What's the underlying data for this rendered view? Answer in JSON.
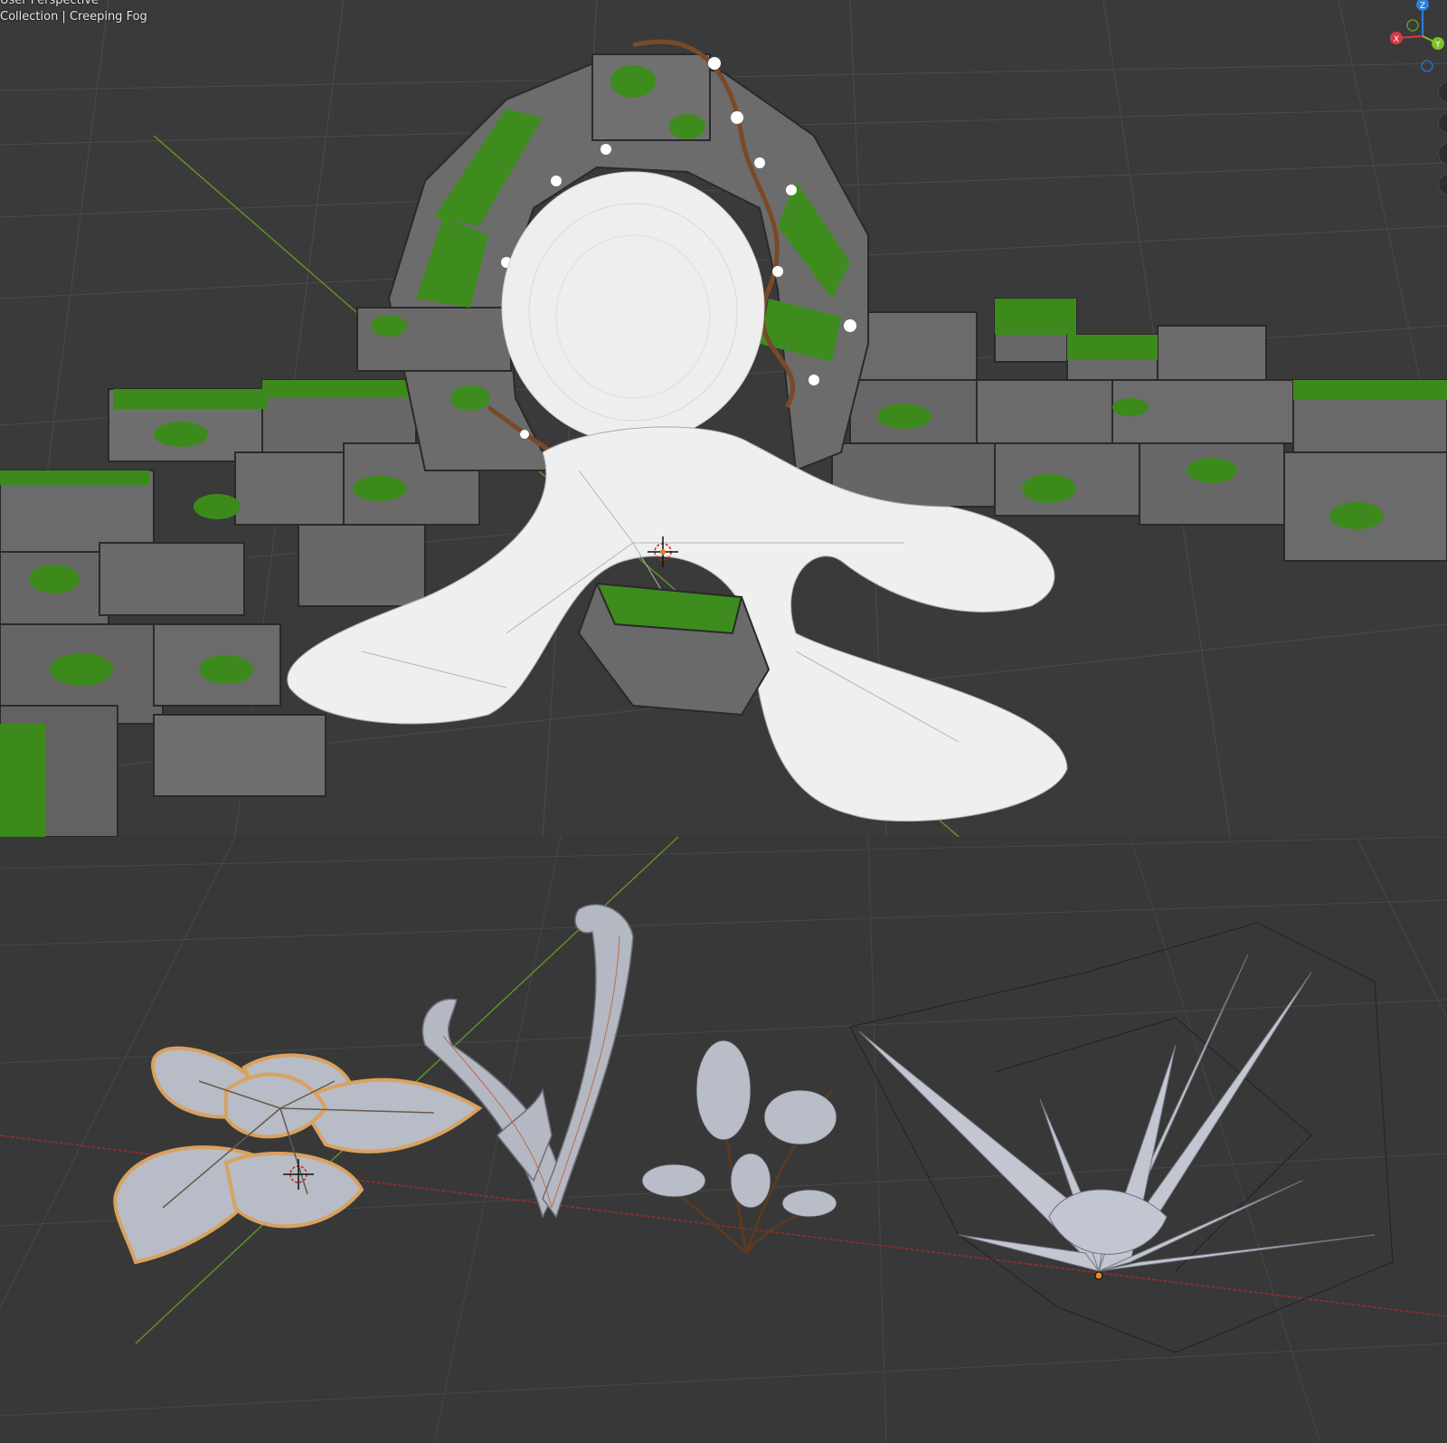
{
  "viewport_top": {
    "view_label": "User Perspective",
    "collection_label": "Collection | Creeping Fog"
  },
  "gizmo": {
    "axes": [
      {
        "name": "Z",
        "color": "#2f7fd6"
      },
      {
        "name": "Y",
        "color": "#7fbf2a"
      },
      {
        "name": "X",
        "color": "#d63a4a"
      }
    ]
  },
  "colors": {
    "grid_line": "#4a4a4a",
    "y_axis": "#6a9a2a",
    "x_axis": "#a03030",
    "stone": "#6a6a6a",
    "moss": "#3f8a1e",
    "portal_mesh": "#efefef",
    "plant_leaf": "#b8bcc6",
    "leaf_outline": "#d9a25f"
  },
  "objects": [
    {
      "name": "stone-arch-portal",
      "type": "mesh"
    },
    {
      "name": "stone-wall-left",
      "type": "mesh"
    },
    {
      "name": "stone-wall-right",
      "type": "mesh"
    },
    {
      "name": "portal-roots",
      "type": "mesh"
    },
    {
      "name": "broad-leaf-plant",
      "type": "mesh"
    },
    {
      "name": "curled-fern-sprout",
      "type": "mesh"
    },
    {
      "name": "fern-plant",
      "type": "mesh"
    },
    {
      "name": "spiky-grass-plant",
      "type": "mesh"
    }
  ]
}
